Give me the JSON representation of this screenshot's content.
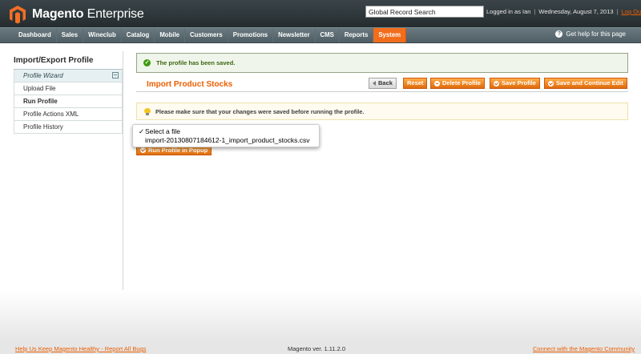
{
  "header": {
    "logo_brand": "Magento",
    "logo_edition": "Enterprise",
    "search_value": "Global Record Search",
    "logged_in": "Logged in as Ian",
    "date": "Wednesday, August 7, 2013",
    "logout": "Log Out"
  },
  "nav": {
    "items": [
      "Dashboard",
      "Sales",
      "Wineclub",
      "Catalog",
      "Mobile",
      "Customers",
      "Promotions",
      "Newsletter",
      "CMS",
      "Reports",
      "System"
    ],
    "active": "System",
    "help": "Get help for this page"
  },
  "sidebar": {
    "title": "Import/Export Profile",
    "tabs": [
      {
        "label": "Profile Wizard",
        "type": "header"
      },
      {
        "label": "Upload File",
        "type": "normal"
      },
      {
        "label": "Run Profile",
        "type": "active"
      },
      {
        "label": "Profile Actions XML",
        "type": "normal"
      },
      {
        "label": "Profile History",
        "type": "normal"
      }
    ]
  },
  "main": {
    "success_message": "The profile has been saved.",
    "title": "Import Product Stocks",
    "buttons": {
      "back": "Back",
      "reset": "Reset",
      "delete": "Delete Profile",
      "save": "Save Profile",
      "save_continue": "Save and Continue Edit"
    },
    "notice": "Please make sure that your changes were saved before running the profile.",
    "file_select": {
      "options": [
        "Select a file",
        "import-20130807184612-1_import_product_stocks.csv"
      ],
      "checked_mark": "✓"
    },
    "run_button": "Run Profile in Popup"
  },
  "footer": {
    "left": "Help Us Keep Magento Healthy - Report All Bugs",
    "version": "Magento ver. 1.11.2.0",
    "right": "Connect with the Magento Community"
  },
  "colors": {
    "accent": "#eb5e00",
    "header_bg": "#2d3639",
    "nav_bg": "#5a6a70",
    "success_bg": "#eff5ea",
    "notice_bg": "#fffbf0"
  }
}
